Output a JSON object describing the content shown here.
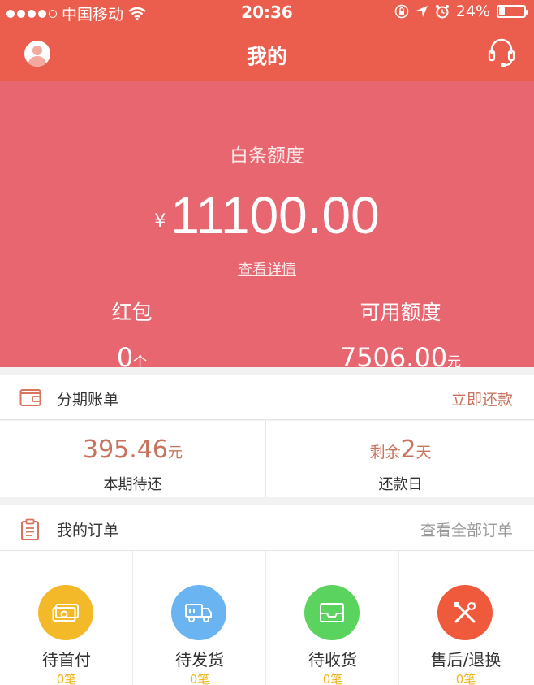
{
  "status_bar": {
    "carrier": "中国移动",
    "time": "20:36",
    "battery": "24%",
    "battery_level": 0.24
  },
  "nav": {
    "title": "我的"
  },
  "credit": {
    "label": "白条额度",
    "currency_symbol": "¥",
    "amount": "11100.00",
    "detail_link": "查看详情",
    "red_packet_label": "红包",
    "red_packet_value": "0",
    "red_packet_unit": "个",
    "available_label": "可用额度",
    "available_value": "7506.00",
    "available_unit": "元"
  },
  "installment": {
    "title": "分期账单",
    "action": "立即还款",
    "due_amount": "395.46",
    "due_unit": "元",
    "due_label": "本期待还",
    "remaining_prefix": "剩余",
    "remaining_days": "2",
    "remaining_unit": "天",
    "repay_label": "还款日"
  },
  "orders": {
    "title": "我的订单",
    "view_all": "查看全部订单",
    "items": [
      {
        "label": "待首付",
        "count": "0笔",
        "color": "#f3b928",
        "icon": "money-icon"
      },
      {
        "label": "待发货",
        "count": "0笔",
        "color": "#6ab4f2",
        "icon": "truck-icon"
      },
      {
        "label": "待收货",
        "count": "0笔",
        "color": "#5bd35f",
        "icon": "inbox-icon"
      },
      {
        "label": "售后/退换",
        "count": "0笔",
        "color": "#ef5a3c",
        "icon": "tools-icon"
      }
    ]
  },
  "colors": {
    "brand_red": "#eb5e4e",
    "hero_pink": "#e86670",
    "accent_brown": "#c8735e"
  }
}
